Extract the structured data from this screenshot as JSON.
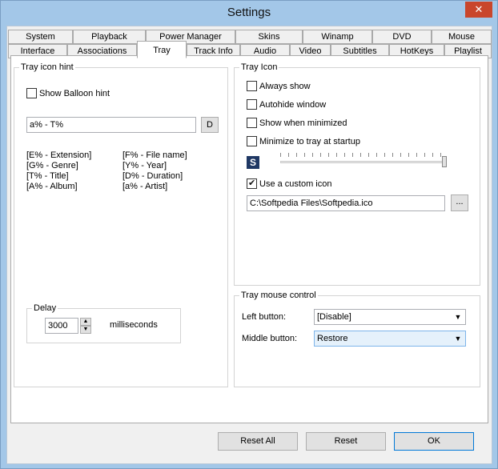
{
  "window": {
    "title": "Settings",
    "close_glyph": "✕"
  },
  "tabs_row1": [
    "System",
    "Playback",
    "Power Manager",
    "Skins",
    "Winamp",
    "DVD",
    "Mouse"
  ],
  "tabs_row2": [
    "Interface",
    "Associations",
    "Tray",
    "Track Info",
    "Audio",
    "Video",
    "Subtitles",
    "HotKeys",
    "Playlist"
  ],
  "active_tab": "Tray",
  "tray_icon_hint": {
    "title": "Tray icon hint",
    "show_balloon_label": "Show Balloon hint",
    "show_balloon_checked": false,
    "format_value": "a% - T%",
    "default_button": "D",
    "legend_left": [
      "[E% - Extension]",
      "[G% - Genre]",
      "[T% - Title]",
      "[A% - Album]"
    ],
    "legend_right": [
      "[F% - File name]",
      "[Y% - Year]",
      "[D% - Duration]",
      "[a% - Artist]"
    ],
    "delay_title": "Delay",
    "delay_value": "3000",
    "delay_unit": "milliseconds"
  },
  "tray_icon": {
    "title": "Tray Icon",
    "always_show": "Always show",
    "autohide": "Autohide window",
    "show_minimized": "Show when minimized",
    "minimize_startup": "Minimize to tray at startup",
    "icon_preview_letter": "S",
    "use_custom_icon": "Use a custom icon",
    "use_custom_icon_checked": true,
    "icon_path": "C:\\Softpedia Files\\Softpedia.ico",
    "browse_button": "...",
    "slider_level": 1.0
  },
  "tray_mouse": {
    "title": "Tray mouse control",
    "left_label": "Left button:",
    "left_value": "[Disable]",
    "middle_label": "Middle button:",
    "middle_value": "Restore"
  },
  "footer": {
    "reset_all": "Reset All",
    "reset": "Reset",
    "ok": "OK"
  },
  "colors": {
    "title_bar": "#a3c7e8",
    "close_button": "#c9462c",
    "icon_preview_bg": "#1f3864"
  }
}
